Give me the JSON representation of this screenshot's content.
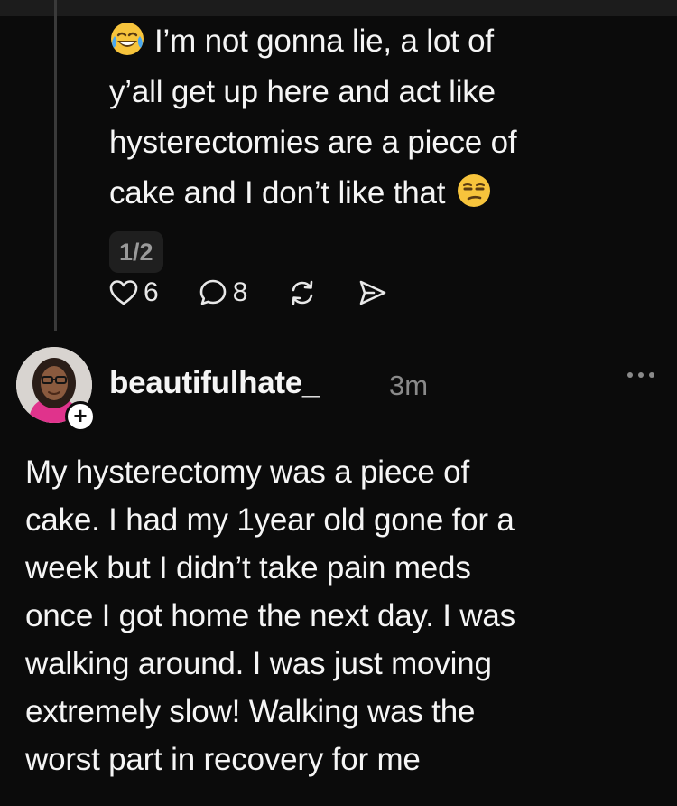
{
  "previous_post": {
    "lines": [
      "I’m not gonna lie, a lot of",
      "y’all get up here and act like",
      "hysterectomies are a piece of",
      "cake and I don’t like that"
    ],
    "leading_emoji": "face-with-tears-of-joy",
    "trailing_emoji": "unamused-face",
    "page_indicator": "1/2",
    "likes": "6",
    "replies": "8"
  },
  "reply": {
    "username": "beautifulhate_",
    "timestamp": "3m",
    "follow_symbol": "+",
    "more_symbol": "•••",
    "body_lines": [
      "My hysterectomy was a piece of",
      "cake. I had my 1year old gone for a",
      "week but I didn’t take pain meds",
      "once I got home the next day. I was",
      "walking around. I was just moving",
      "extremely slow! Walking was the",
      "worst part in recovery for me"
    ]
  },
  "colors": {
    "background": "#0b0b0b",
    "text": "#f5f5f5",
    "muted": "#8a8a8a",
    "thread_line": "#3a3a3a"
  }
}
